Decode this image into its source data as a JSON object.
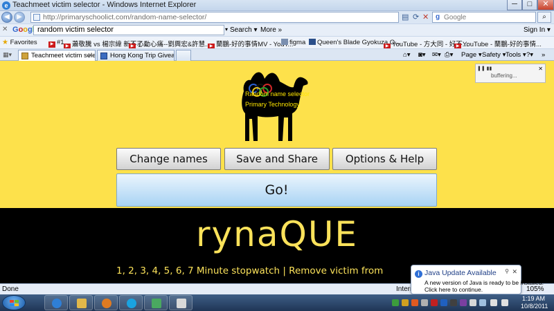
{
  "window": {
    "title": "Teachmeet victim selector - Windows Internet Explorer",
    "controls": {
      "minimize": "─",
      "maximize": "□",
      "close": "✕"
    }
  },
  "address": {
    "url": "http://primaryschoolict.com/random-name-selector/",
    "search_placeholder": "Google"
  },
  "google_toolbar": {
    "logo": "Google",
    "query": "random victim selector",
    "search_label": "Search ▾",
    "more_label": "More »",
    "sign_in": "Sign In ▾"
  },
  "favorites": {
    "label": "Favorites",
    "items": [
      {
        "label": "#1",
        "icon": "youtube"
      },
      {
        "label": "蕭敬騰 vs 楊宗緯 新不了...",
        "icon": "youtube"
      },
      {
        "label": "心動心痛--劉興宏&許慧...",
        "icon": "youtube"
      },
      {
        "label": "蘭鵬-好的事情MV - YouT...",
        "icon": "youtube"
      },
      {
        "label": "figma",
        "icon": "page"
      },
      {
        "label": "Queen's Blade Gyokuza O...",
        "icon": "page"
      },
      {
        "label": "YouTube - 方大同 - 好不...",
        "icon": "youtube"
      },
      {
        "label": "YouTube - 蘭鵬-好的事情...",
        "icon": "youtube"
      }
    ]
  },
  "tabs": [
    {
      "label": "Teachmeet victim selec...",
      "active": true
    },
    {
      "label": "Hong Kong Trip Giveaway ...",
      "active": false
    }
  ],
  "command_bar": {
    "page": "Page ▾",
    "safety": "Safety ▾",
    "tools": "Tools ▾"
  },
  "app": {
    "camel_text_line1": "Random name selector",
    "camel_text_line2": "Primary Technology",
    "buffer_text": "buffering...",
    "buttons": {
      "change_names": "Change names",
      "save_share": "Save and Share",
      "options_help": "Options & Help",
      "go": "Go!"
    },
    "selected_name": "rynaQUE",
    "stopwatch_line": "1, 2, 3, 4, 5, 6, 7 Minute stopwatch | Remove victim from"
  },
  "status": {
    "text": "Done",
    "zone": "Internet",
    "zoom": "105%"
  },
  "java_popup": {
    "title": "Java Update Available",
    "line1": "A new version of Java is ready to be installed!",
    "line2": "Click here to continue."
  },
  "taskbar": {
    "time": "1:19 AM",
    "date": "10/8/2011"
  },
  "colors": {
    "page_yellow": "#fde14b",
    "page_black": "#000000",
    "name_text": "#fbe25a",
    "go_blue": "#a8d3f4"
  }
}
